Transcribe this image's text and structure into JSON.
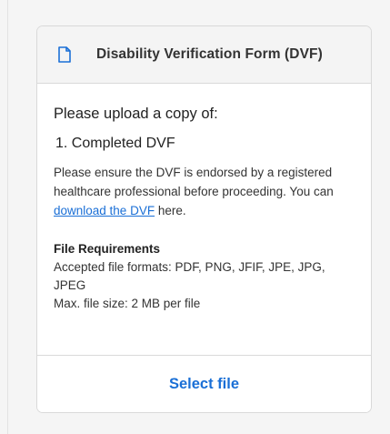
{
  "card": {
    "title": "Disability Verification Form (DVF)",
    "header_icon": "document-icon",
    "upload_prompt": "Please upload a copy of:",
    "required_documents": [
      "1. Completed DVF"
    ],
    "instructions_before_link": "Please ensure the DVF is endorsed by a registered healthcare professional before proceeding. You can ",
    "download_link_label": "download the DVF",
    "instructions_after_link": " here.",
    "file_requirements": {
      "title": "File Requirements",
      "formats": "Accepted file formats: PDF, PNG, JFIF, JPE, JPG, JPEG",
      "max_size": "Max. file size: 2 MB per file"
    },
    "select_file_label": "Select file"
  },
  "colors": {
    "link": "#1a6fd6",
    "header_bg": "#f4f4f4",
    "border": "#d9d9d9"
  }
}
